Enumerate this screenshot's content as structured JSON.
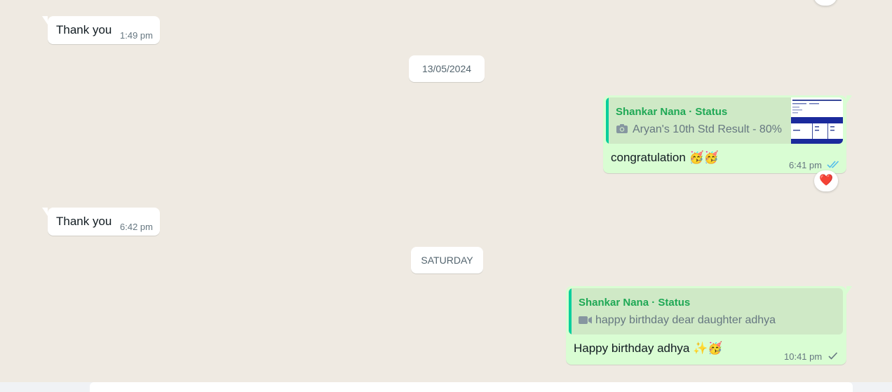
{
  "messages": [
    {
      "text": "Thank you",
      "time": "1:49 pm"
    },
    {
      "date": "13/05/2024"
    },
    {
      "quote_author": "Shankar Nana · Status",
      "quote_caption": "Aryan's 10th Std Result - 80%",
      "quote_icon": "camera-icon",
      "text": "congratulation 🥳🥳",
      "time": "6:41 pm",
      "status": "read",
      "reaction": "❤️"
    },
    {
      "text": "Thank you",
      "time": "6:42 pm"
    },
    {
      "date": "SATURDAY"
    },
    {
      "quote_author": "Shankar Nana · Status",
      "quote_caption": "happy birthday dear daughter adhya",
      "quote_icon": "video-icon",
      "text": "Happy birthday adhya ✨🥳",
      "time": "10:41 pm",
      "status": "sent"
    }
  ],
  "colors": {
    "chat_bg": "#efeae2",
    "outgoing_bubble": "#d9fdd3",
    "incoming_bubble": "#ffffff",
    "quote_accent": "#06cf9c",
    "quote_author": "#1fa855",
    "read_ticks": "#53bdeb",
    "sent_tick": "#667781"
  }
}
